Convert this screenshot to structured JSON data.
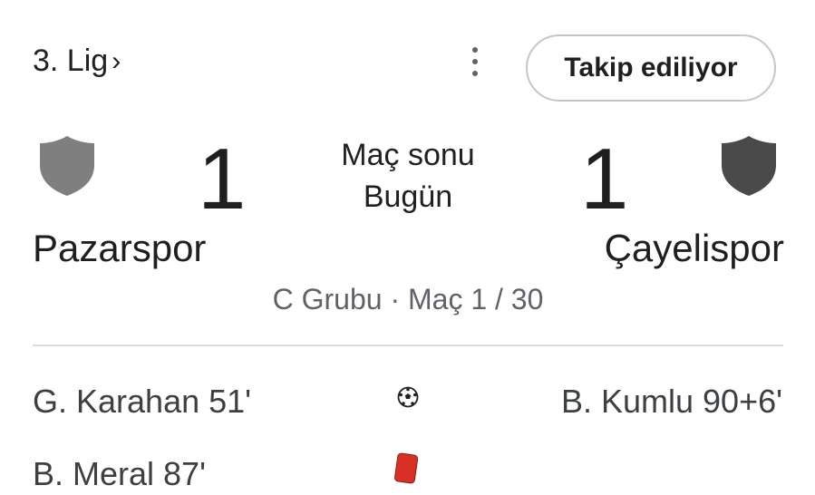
{
  "header": {
    "league_label": "3. Lig",
    "league_chevron": "›",
    "follow_label": "Takip ediliyor"
  },
  "match": {
    "status": "Maç sonu",
    "date": "Bugün",
    "home": {
      "name": "Pazarspor",
      "score": "1",
      "crest_color": "#7f7f7f"
    },
    "away": {
      "name": "Çayelispor",
      "score": "1",
      "crest_color": "#4a4a4a"
    },
    "group_info": "C Grubu · Maç 1 / 30"
  },
  "events": {
    "goal_home": "G. Karahan 51'",
    "goal_away": "B. Kumlu 90+6'",
    "card_home": "B. Meral 87'",
    "goal_icon": "soccer-ball-icon",
    "card_icon": "red-card-icon",
    "card_color": "#d93025"
  }
}
